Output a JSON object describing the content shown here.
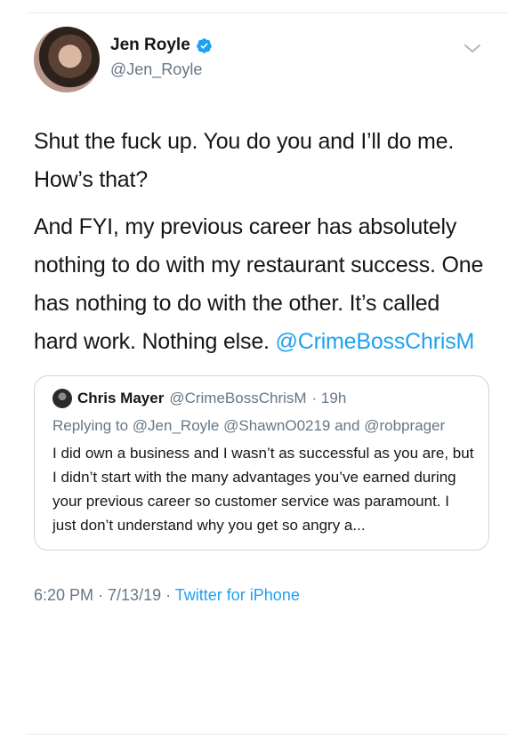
{
  "tweet": {
    "author": {
      "name": "Jen Royle",
      "handle": "@Jen_Royle",
      "verified": true
    },
    "paragraphs": [
      "Shut the fuck up. You do you and I’ll do me. How’s that?",
      "And FYI, my previous career has absolutely nothing to do with my restaurant success. One has nothing to do with the other. It’s called hard work. Nothing else."
    ],
    "trailing_mention": "@CrimeBossChrisM",
    "timestamp": "6:20 PM · 7/13/19 ·",
    "source": "Twitter for iPhone"
  },
  "quoted": {
    "name": "Chris Mayer",
    "handle": "@CrimeBossChrisM",
    "age": "· 19h",
    "reply_prefix": "Replying to",
    "reply_to": "@Jen_Royle @ShawnO0219 and @robprager",
    "text": "I did own a business and I wasn’t as successful as you are, but I didn’t start with the many advantages you’ve earned during your previous career so customer service was paramount. I just don’t understand why you get so angry a..."
  },
  "colors": {
    "link": "#1da1f2",
    "muted": "#657786",
    "text": "#14171a",
    "border": "#ccd6dd"
  }
}
